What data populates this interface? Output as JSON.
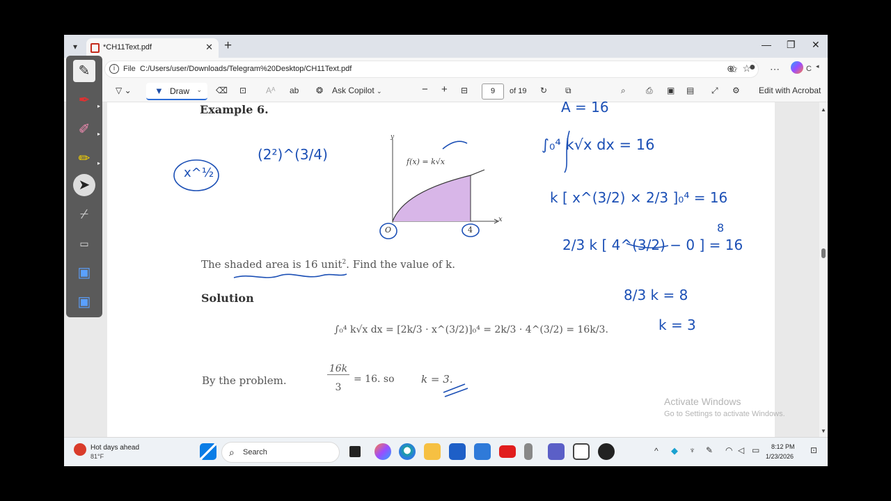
{
  "browser": {
    "tab_title": "*CH11Text.pdf",
    "address_scheme": "File",
    "url": "C:/Users/user/Downloads/Telegram%20Desktop/CH11Text.pdf",
    "profile_label": "C"
  },
  "pdf_toolbar": {
    "draw_label": "Draw",
    "copilot_label": "Ask Copilot",
    "page_number": "9",
    "page_total": "of 19",
    "edit_acrobat": "Edit with Acrobat"
  },
  "document": {
    "heading": "Example 6.",
    "fx_label": "f(x) = k√x",
    "axis_y": "y",
    "axis_x": "x",
    "origin": "O",
    "x_tick": "4",
    "problem_pre": "The shaded area is 16 unit",
    "problem_sup": "2",
    "problem_post": ". Find the value of k.",
    "solution_title": "Solution",
    "integral_line": "∫₀⁴ k√x dx = [2k/3 · x^(3/2)]₀⁴ = 2k/3 · 4^(3/2) = 16k/3.",
    "by_problem": "By the problem.",
    "frac_num": "16k",
    "frac_den": "3",
    "conclusion_mid": "= 16.  so",
    "conclusion_end": "k = 3."
  },
  "handwriting": {
    "area_eq": "A = 16",
    "line2": "∫₀⁴ k√x dx = 16",
    "line3": "k [ x^(3/2) × 2/3 ]₀⁴ = 16",
    "line4": "2/3 k [ 4^(3/2) − 0 ] = 16",
    "line4_over": "8",
    "line5": "8/3 k = 8",
    "line6": "k = 3",
    "left_note1": "x^½",
    "left_note2": "(2²)^(3/4)"
  },
  "watermark": {
    "title": "Activate Windows",
    "subtitle": "Go to Settings to activate Windows."
  },
  "taskbar": {
    "weather_title": "Hot days ahead",
    "weather_temp": "81°F",
    "search_label": "Search",
    "time": "8:12 PM",
    "date": "1/23/2026"
  }
}
